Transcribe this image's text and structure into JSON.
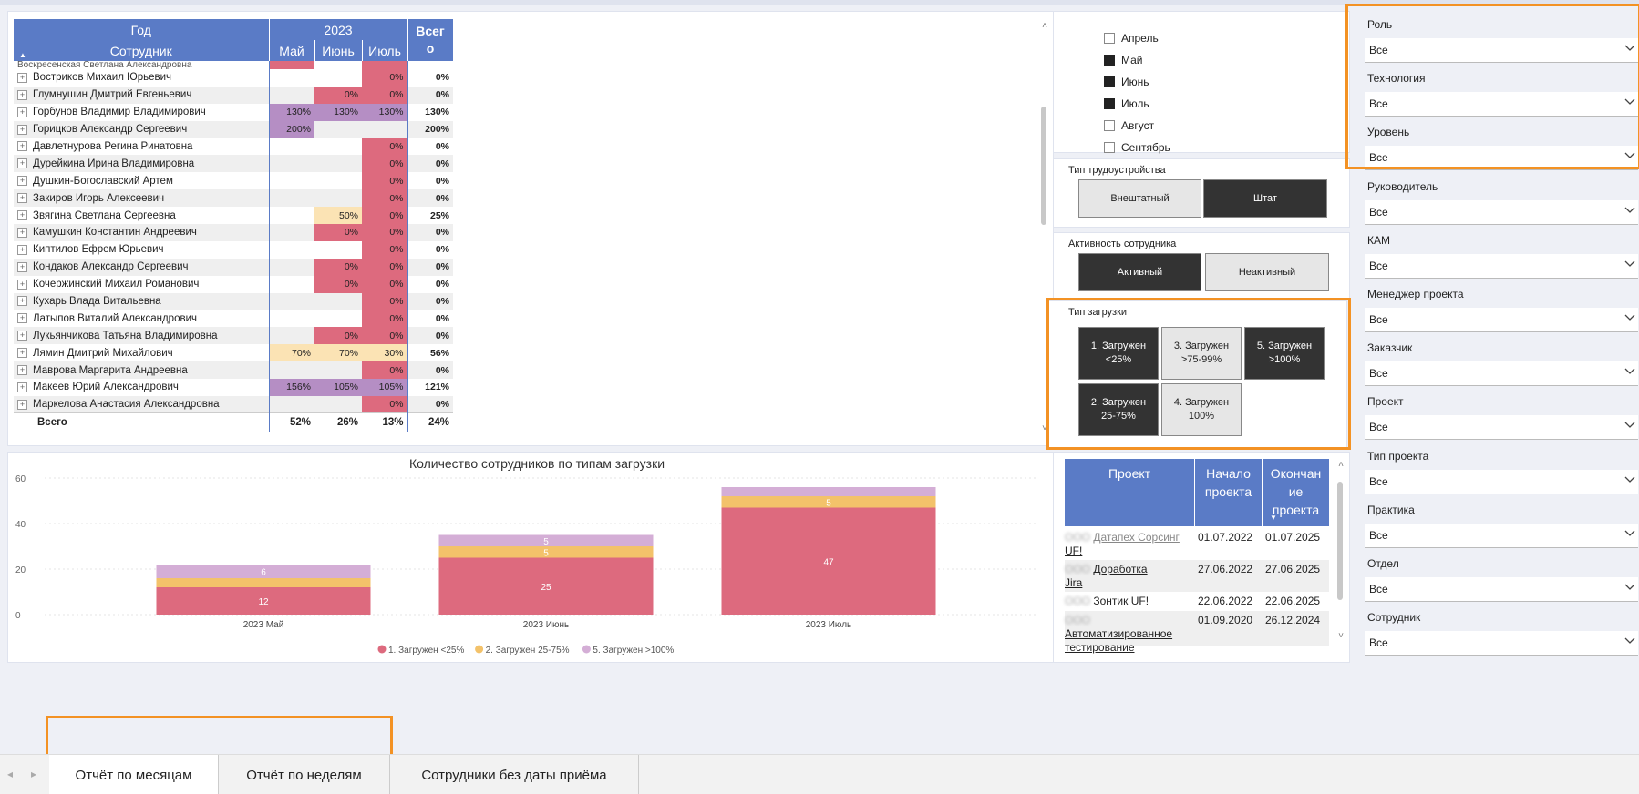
{
  "matrix": {
    "header_year_label": "Год",
    "header_year_value": "2023",
    "header_total": "Всего",
    "header_employee": "Сотрудник",
    "months": [
      "Май",
      "Июнь",
      "Июль"
    ],
    "partial_row": "Воскресенская Светлана Александровна",
    "rows": [
      {
        "name": "Востриков Михаил Юрьевич",
        "may": "",
        "jun": "",
        "jul": "0%",
        "total": "0%"
      },
      {
        "name": "Глумнушин Дмитрий Евгеньевич",
        "may": "",
        "jun": "0%",
        "jul": "0%",
        "total": "0%"
      },
      {
        "name": "Горбунов Владимир Владимирович",
        "may": "130%",
        "jun": "130%",
        "jul": "130%",
        "total": "130%"
      },
      {
        "name": "Горицков Александр Сергеевич",
        "may": "200%",
        "jun": "",
        "jul": "",
        "total": "200%"
      },
      {
        "name": "Давлетнурова Регина Ринатовна",
        "may": "",
        "jun": "",
        "jul": "0%",
        "total": "0%"
      },
      {
        "name": "Дурейкина Ирина Владимировна",
        "may": "",
        "jun": "",
        "jul": "0%",
        "total": "0%"
      },
      {
        "name": "Душкин-Богославский Артем",
        "may": "",
        "jun": "",
        "jul": "0%",
        "total": "0%"
      },
      {
        "name": "Закиров Игорь Алексеевич",
        "may": "",
        "jun": "",
        "jul": "0%",
        "total": "0%"
      },
      {
        "name": "Звягина Светлана Сергеевна",
        "may": "",
        "jun": "50%",
        "jul": "0%",
        "total": "25%"
      },
      {
        "name": "Камушкин Константин Андреевич",
        "may": "",
        "jun": "0%",
        "jul": "0%",
        "total": "0%"
      },
      {
        "name": "Киптилов Ефрем Юрьевич",
        "may": "",
        "jun": "",
        "jul": "0%",
        "total": "0%"
      },
      {
        "name": "Кондаков Александр Сергеевич",
        "may": "",
        "jun": "0%",
        "jul": "0%",
        "total": "0%"
      },
      {
        "name": "Кочержинский Михаил Романович",
        "may": "",
        "jun": "0%",
        "jul": "0%",
        "total": "0%"
      },
      {
        "name": "Кухарь Влада Витальевна",
        "may": "",
        "jun": "",
        "jul": "0%",
        "total": "0%"
      },
      {
        "name": "Латыпов Виталий Александрович",
        "may": "",
        "jun": "",
        "jul": "0%",
        "total": "0%"
      },
      {
        "name": "Лукьянчикова Татьяна Владимировна",
        "may": "",
        "jun": "0%",
        "jul": "0%",
        "total": "0%"
      },
      {
        "name": "Лямин Дмитрий Михайлович",
        "may": "70%",
        "jun": "70%",
        "jul": "30%",
        "total": "56%"
      },
      {
        "name": "Маврова Маргарита Андреевна",
        "may": "",
        "jun": "",
        "jul": "0%",
        "total": "0%"
      },
      {
        "name": "Макеев Юрий Александрович",
        "may": "156%",
        "jun": "105%",
        "jul": "105%",
        "total": "121%"
      },
      {
        "name": "Маркелова Анастасия Александровна",
        "may": "",
        "jun": "",
        "jul": "0%",
        "total": "0%"
      }
    ],
    "total_row": {
      "name": "Всего",
      "may": "52%",
      "jun": "26%",
      "jul": "13%",
      "total": "24%"
    }
  },
  "colors": {
    "header_blue": "#5a7bc6",
    "zero_red": "#dd6a7e",
    "over_purple": "#b58ec4",
    "mid_yellow": "#fbe3b4",
    "orange_highlight": "#f39224"
  },
  "months_slicer": {
    "items": [
      {
        "label": "Апрель",
        "checked": false
      },
      {
        "label": "Май",
        "checked": true
      },
      {
        "label": "Июнь",
        "checked": true
      },
      {
        "label": "Июль",
        "checked": true
      },
      {
        "label": "Август",
        "checked": false
      },
      {
        "label": "Сентябрь",
        "checked": false
      }
    ]
  },
  "employment_slicer": {
    "title": "Тип трудоустройства",
    "options": [
      {
        "label": "Внештатный",
        "selected": false
      },
      {
        "label": "Штат",
        "selected": true
      }
    ]
  },
  "activity_slicer": {
    "title": "Активность сотрудника",
    "options": [
      {
        "label": "Активный",
        "selected": true
      },
      {
        "label": "Неактивный",
        "selected": false
      }
    ]
  },
  "load_slicer": {
    "title": "Тип загрузки",
    "options": [
      {
        "label": "1. Загружен <25%",
        "selected": true
      },
      {
        "label": "3. Загружен >75-99%",
        "selected": false
      },
      {
        "label": "5. Загружен >100%",
        "selected": true
      },
      {
        "label": "2. Загружен 25-75%",
        "selected": true
      },
      {
        "label": "4. Загружен 100%",
        "selected": false
      }
    ]
  },
  "chart_data": {
    "type": "bar",
    "stacked": true,
    "title": "Количество сотрудников по типам загрузки",
    "categories": [
      "2023 Май",
      "2023 Июнь",
      "2023 Июль"
    ],
    "series": [
      {
        "name": "1. Загружен <25%",
        "color": "#dd6a7e",
        "values": [
          12,
          25,
          47
        ]
      },
      {
        "name": "2. Загружен 25-75%",
        "color": "#f3c26a",
        "values": [
          4,
          5,
          5
        ]
      },
      {
        "name": "5. Загружен >100%",
        "color": "#d4aed6",
        "values": [
          6,
          5,
          4
        ]
      }
    ],
    "data_labels": [
      [
        "12",
        "",
        "6"
      ],
      [
        "25",
        "5",
        "5"
      ],
      [
        "47",
        "5",
        ""
      ]
    ],
    "y_ticks": [
      0,
      20,
      40,
      60
    ],
    "ylim": [
      0,
      60
    ],
    "legend_position": "bottom"
  },
  "projects_table": {
    "headers": {
      "project": "Проект",
      "start": "Начало проекта",
      "end": "Окончание проекта"
    },
    "header_start_lines": [
      "Начало",
      "проекта"
    ],
    "header_end_lines": [
      "Окончан",
      "ие",
      "проекта"
    ],
    "rows": [
      {
        "prefix": "ООО",
        "name": "Датапех Сорсинг",
        "name2": "UF!",
        "start": "01.07.2022",
        "end": "01.07.2025"
      },
      {
        "prefix": "ООО",
        "name": "Доработка",
        "name2": "Jira",
        "start": "27.06.2022",
        "end": "27.06.2025"
      },
      {
        "prefix": "ООО",
        "name": "Зонтик UF!",
        "name2": "",
        "start": "22.06.2022",
        "end": "22.06.2025"
      },
      {
        "prefix": "ООО",
        "name": "Автоматизированное",
        "name2": "тестирование",
        "start": "01.09.2020",
        "end": "26.12.2024"
      }
    ]
  },
  "filters": [
    {
      "label": "Роль",
      "value": "Все"
    },
    {
      "label": "Технология",
      "value": "Все"
    },
    {
      "label": "Уровень",
      "value": "Все"
    },
    {
      "label": "Руководитель",
      "value": "Все"
    },
    {
      "label": "КАМ",
      "value": "Все"
    },
    {
      "label": "Менеджер проекта",
      "value": "Все"
    },
    {
      "label": "Заказчик",
      "value": "Все"
    },
    {
      "label": "Проект",
      "value": "Все"
    },
    {
      "label": "Тип проекта",
      "value": "Все"
    },
    {
      "label": "Практика",
      "value": "Все"
    },
    {
      "label": "Отдел",
      "value": "Все"
    },
    {
      "label": "Сотрудник",
      "value": "Все"
    }
  ],
  "tabs": [
    {
      "label": "Отчёт по месяцам",
      "active": true
    },
    {
      "label": "Отчёт по неделям",
      "active": false
    },
    {
      "label": "Сотрудники без даты приёма",
      "active": false
    }
  ]
}
